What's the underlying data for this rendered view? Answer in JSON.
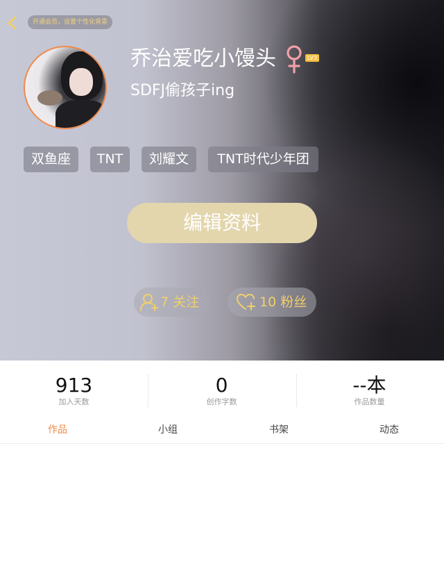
{
  "header": {
    "vip_banner": "开通会员，设置个性化背景",
    "nickname": "乔治爱吃小馒头",
    "gender_symbol": "♀",
    "gender_color": "#f2a0a8",
    "level": "LV3",
    "signature": "SDFJ偷孩子ing",
    "tags": [
      "双鱼座",
      "TNT",
      "刘耀文",
      "TNT时代少年团"
    ],
    "edit_button": "编辑资料",
    "following": "7 关注",
    "followers": "10 粉丝",
    "accent_color": "#f08a4b"
  },
  "stats": [
    {
      "value": "913",
      "label": "加入天数"
    },
    {
      "value": "0",
      "label": "创作字数"
    },
    {
      "value": "--本",
      "label": "作品数量"
    }
  ],
  "tabs": [
    {
      "label": "作品",
      "active": true
    },
    {
      "label": "小组",
      "active": false
    },
    {
      "label": "书架",
      "active": false
    },
    {
      "label": "动态",
      "active": false
    }
  ],
  "icons": {
    "back": "chevron-left-icon",
    "follow": "user-add-icon",
    "fans": "heart-add-icon"
  }
}
